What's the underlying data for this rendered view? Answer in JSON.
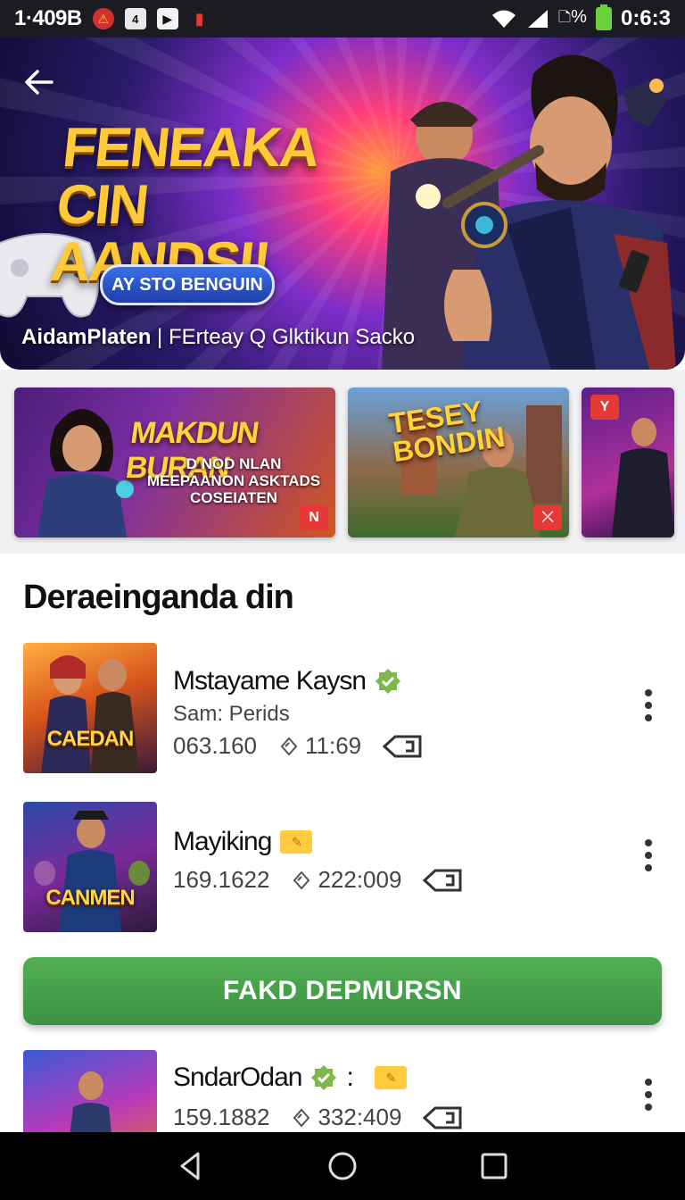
{
  "status_bar": {
    "left_text": "1·409B",
    "icon_a": "⚠",
    "icon_b": "4",
    "icon_c": "▶",
    "icon_d": "▮",
    "battery_text": "🗅%",
    "time": "0:6:3"
  },
  "hero": {
    "title_line1": "FENEAKA",
    "title_line2": "CIN AANDSI!",
    "pill": "AY STO BENGUIN",
    "caption_strong": "AidamPlaten",
    "caption_rest": "| FErteay  Q  Glktikun  Sacko"
  },
  "promos": [
    {
      "title": "MAKDUN BURAN",
      "sub": "D NOD NLAN MEEPAANON ASKTADS COSEIATEN",
      "badge": "N"
    },
    {
      "title": "TESEY BONDIN",
      "badge": "⤫"
    },
    {
      "title": "",
      "badge": "Y"
    }
  ],
  "section": {
    "title": "Deraeinganda din"
  },
  "games": [
    {
      "name": "Mstayame Kaysn",
      "sub": "Sam: Perids",
      "stat1": "063.160",
      "stat2": "11:69",
      "thumb_label": "CAEDAN"
    },
    {
      "name": "Mayiking",
      "sub": "",
      "stat1": "169.1622",
      "stat2": "222:009",
      "thumb_label": "CANMEN"
    },
    {
      "name": "SndarOdan",
      "sub": "",
      "stat1": "159.1882",
      "stat2": "332:409",
      "thumb_label": ""
    }
  ],
  "cta": {
    "label": "FAKD DEPMURSN"
  },
  "colors": {
    "accent_green": "#4ca350",
    "hero_gold": "#ffc93a",
    "verified_green": "#7cb94a"
  },
  "icons": [
    "back-arrow-icon",
    "verified-icon",
    "tag-icon",
    "rating-icon",
    "download-icon",
    "more-vert-icon",
    "nav-back-icon",
    "nav-home-icon",
    "nav-recents-icon"
  ]
}
